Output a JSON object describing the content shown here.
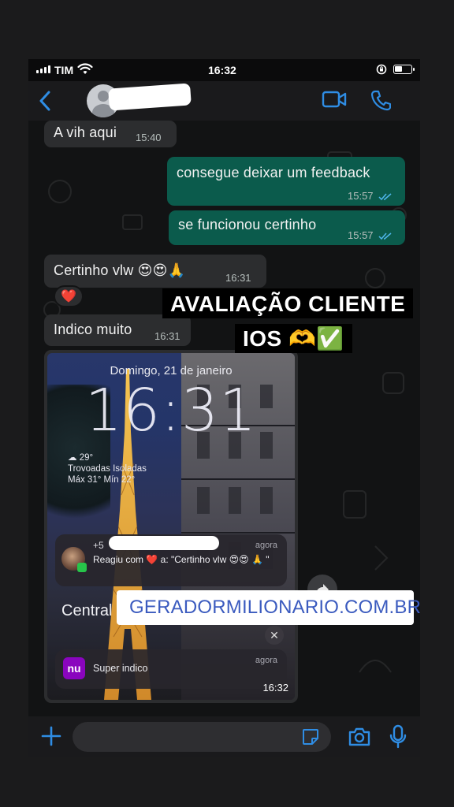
{
  "status_bar": {
    "carrier": "TIM",
    "time": "16:32"
  },
  "header": {
    "avatar_alt": "contact-avatar"
  },
  "messages": [
    {
      "dir": "in",
      "text": "A vih aqui",
      "time": "15:40"
    },
    {
      "dir": "out",
      "text": "consegue deixar um feedback",
      "time": "15:57",
      "read": true
    },
    {
      "dir": "out",
      "text": "se funcionou certinho",
      "time": "15:57",
      "read": true
    },
    {
      "dir": "in",
      "text": "Certinho vlw 😍😍🙏",
      "time": "16:31",
      "reaction": "❤️"
    },
    {
      "dir": "in",
      "text": "Indico muito",
      "time": "16:31"
    }
  ],
  "image_message": {
    "time": "16:32",
    "lockscreen": {
      "date": "Domingo, 21 de janeiro",
      "time": "16:31",
      "weather_temp": "29°",
      "weather_desc": "Trovoadas Isoladas",
      "weather_range": "Máx 31° Mín 22°",
      "notification_1": {
        "sender_prefix": "+5",
        "ago": "agora",
        "body": "Reagiu com ❤️ a: \"Certinho vlw 😍😍 🙏 \""
      },
      "central_text": "Central",
      "notification_2": {
        "app_icon_text": "nu",
        "title": "Super indico",
        "ago": "agora"
      }
    }
  },
  "overlays": {
    "title": "AVALIAÇÃO CLIENTE",
    "subtitle": "IOS 🫶✅",
    "link": "GERADORMILIONARIO.COM.BR"
  },
  "colors": {
    "outgoing_bubble": "#0b5b4c",
    "incoming_bubble": "#2c2d2f",
    "accent": "#2f8de4",
    "link_text": "#3b5bbf"
  }
}
